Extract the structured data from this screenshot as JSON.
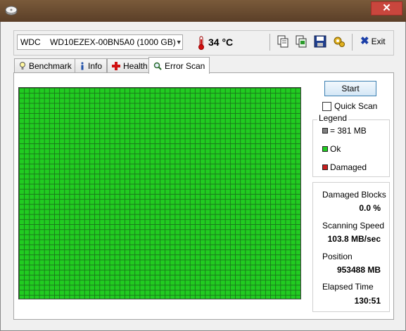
{
  "window": {
    "close_glyph": "✕"
  },
  "toolbar": {
    "drive": "WDC    WD10EZEX-00BN5A0 (1000 GB)",
    "temperature": "34 °C",
    "exit_label": "Exit",
    "icons": [
      "copy-icon",
      "copy-all-icon",
      "save-icon",
      "options-icon"
    ]
  },
  "tabs": [
    {
      "label": "Benchmark",
      "icon": "lightbulb-icon"
    },
    {
      "label": "Info",
      "icon": "info-icon"
    },
    {
      "label": "Health",
      "icon": "health-cross-icon"
    },
    {
      "label": "Error Scan",
      "icon": "magnifier-icon",
      "active": true
    }
  ],
  "scan": {
    "start_label": "Start",
    "quick_scan_label": "Quick Scan",
    "quick_scan_checked": false,
    "block_status": "all ok",
    "block_color_ok": "#21cc21"
  },
  "legend": {
    "title": "Legend",
    "items": [
      {
        "label": "= 381 MB",
        "color": "#808080"
      },
      {
        "label": "Ok",
        "color": "#21cc21"
      },
      {
        "label": "Damaged",
        "color": "#c81e1e"
      }
    ]
  },
  "stats": {
    "damaged_blocks_label": "Damaged Blocks",
    "damaged_blocks_value": "0.0 %",
    "speed_label": "Scanning Speed",
    "speed_value": "103.8 MB/sec",
    "position_label": "Position",
    "position_value": "953488 MB",
    "elapsed_label": "Elapsed Time",
    "elapsed_value": "130:51"
  }
}
